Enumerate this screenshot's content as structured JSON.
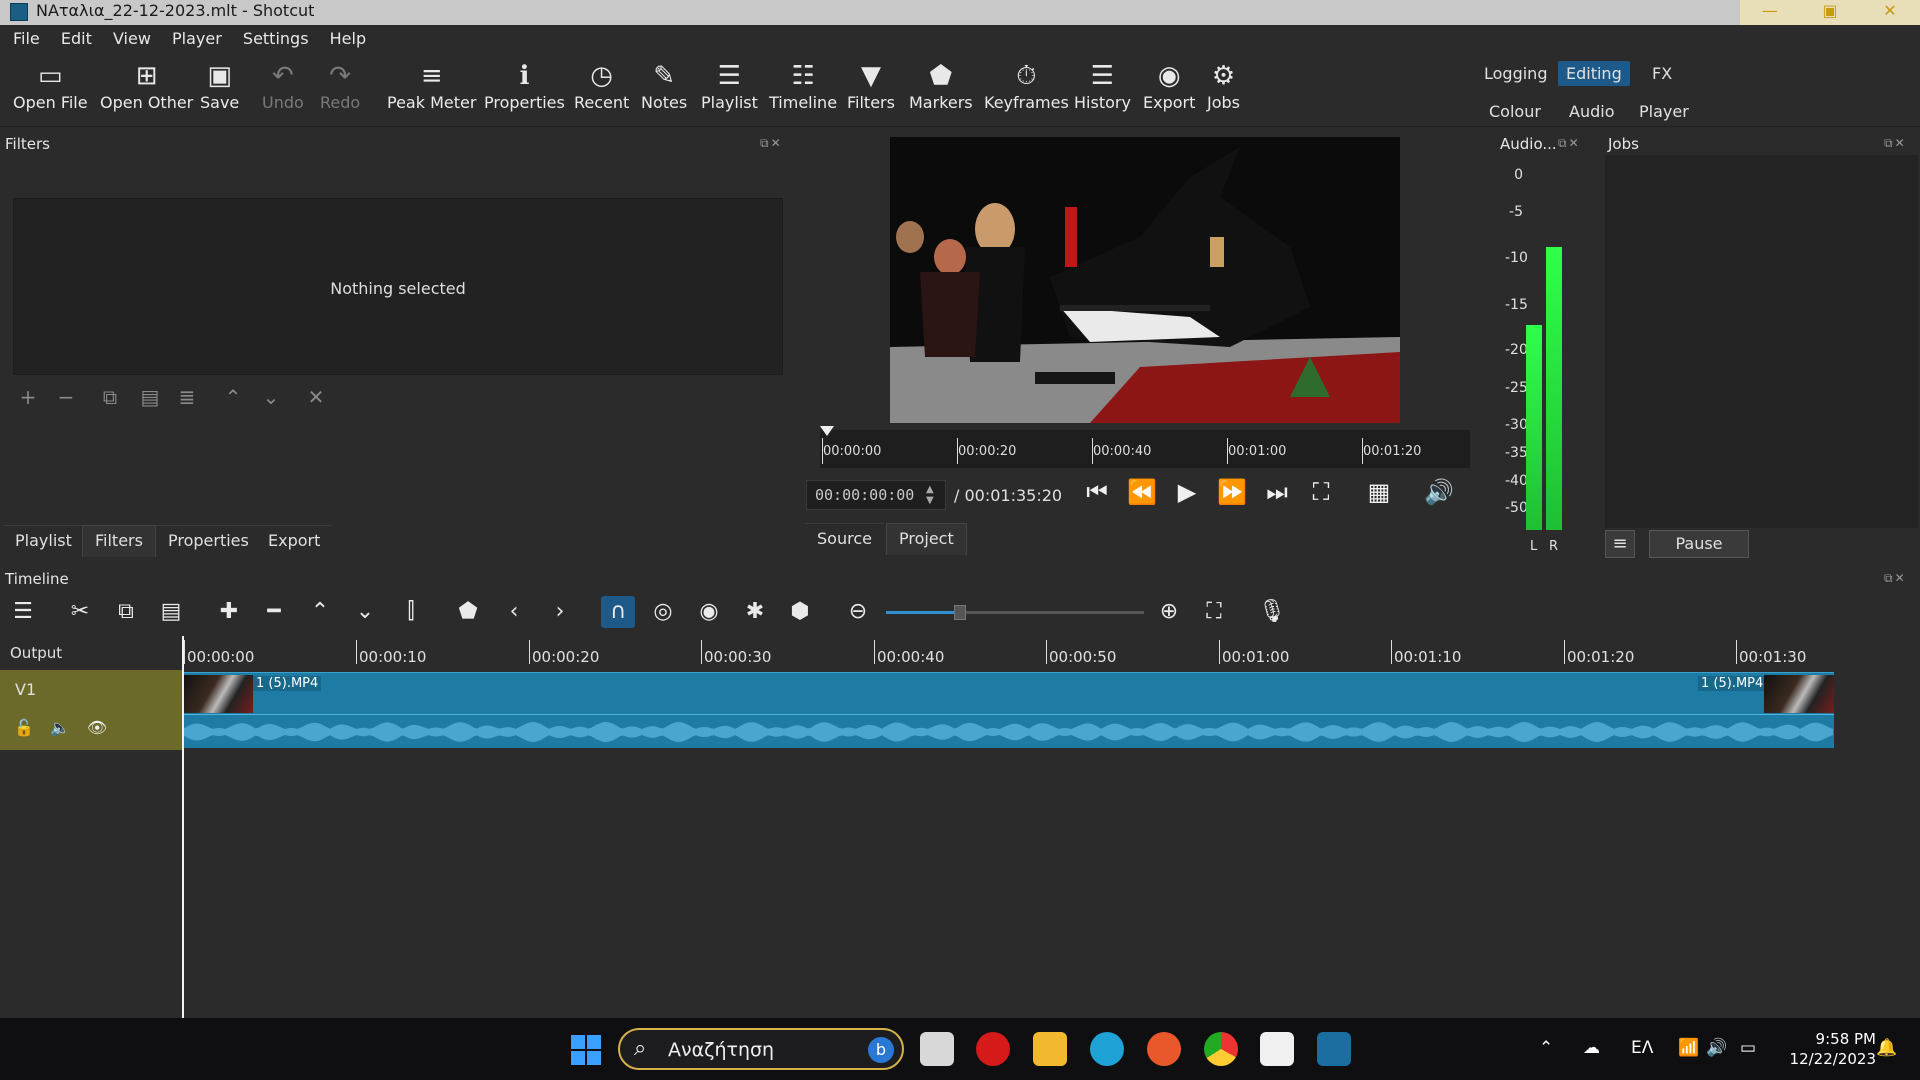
{
  "window": {
    "title": "NΑταλια_22-12-2023.mlt - Shotcut",
    "minimize": "—",
    "maximize": "▣",
    "close": "✕"
  },
  "menu": [
    "File",
    "Edit",
    "View",
    "Player",
    "Settings",
    "Help"
  ],
  "toolbar": [
    {
      "label": "Open File",
      "icon": "open-file-icon",
      "glyph": "▭"
    },
    {
      "label": "Open Other",
      "icon": "open-other-icon",
      "glyph": "⊞"
    },
    {
      "label": "Save",
      "icon": "save-icon",
      "glyph": "▣"
    },
    {
      "label": "Undo",
      "icon": "undo-icon",
      "glyph": "↶"
    },
    {
      "label": "Redo",
      "icon": "redo-icon",
      "glyph": "↷"
    },
    {
      "label": "Peak Meter",
      "icon": "peak-meter-icon",
      "glyph": "≡"
    },
    {
      "label": "Properties",
      "icon": "properties-icon",
      "glyph": "ℹ"
    },
    {
      "label": "Recent",
      "icon": "recent-icon",
      "glyph": "◷"
    },
    {
      "label": "Notes",
      "icon": "notes-icon",
      "glyph": "✎"
    },
    {
      "label": "Playlist",
      "icon": "playlist-icon",
      "glyph": "☰"
    },
    {
      "label": "Timeline",
      "icon": "timeline-icon",
      "glyph": "☷"
    },
    {
      "label": "Filters",
      "icon": "filters-icon",
      "glyph": "▼"
    },
    {
      "label": "Markers",
      "icon": "markers-icon",
      "glyph": "⬟"
    },
    {
      "label": "Keyframes",
      "icon": "keyframes-icon",
      "glyph": "⏱"
    },
    {
      "label": "History",
      "icon": "history-icon",
      "glyph": "☰"
    },
    {
      "label": "Export",
      "icon": "export-icon",
      "glyph": "◉"
    },
    {
      "label": "Jobs",
      "icon": "jobs-icon",
      "glyph": "⚙"
    }
  ],
  "layouts": {
    "logging": "Logging",
    "editing": "Editing",
    "fx": "FX",
    "colour": "Colour",
    "audio": "Audio",
    "player": "Player"
  },
  "filters_panel": {
    "title": "Filters",
    "empty_text": "Nothing selected"
  },
  "left_tabs": [
    "Playlist",
    "Filters",
    "Properties",
    "Export"
  ],
  "preview": {
    "ruler_ticks": [
      "00:00:00",
      "00:00:20",
      "00:00:40",
      "00:01:00",
      "00:01:20"
    ],
    "timecode": "00:00:00:00",
    "duration": "/ 00:01:35:20",
    "tabs": [
      "Source",
      "Project"
    ]
  },
  "audio_meter": {
    "title": "Audio...",
    "scale": [
      "0",
      "-5",
      "-10",
      "-15",
      "-20",
      "-25",
      "-30",
      "-35",
      "-40",
      "-50"
    ],
    "left_label": "L",
    "right_label": "R",
    "left_level_db": -21,
    "right_level_db": -10
  },
  "jobs_panel": {
    "title": "Jobs",
    "menu_glyph": "≡",
    "pause_label": "Pause"
  },
  "timeline": {
    "title": "Timeline",
    "output_label": "Output",
    "track_name": "V1",
    "ruler_ticks": [
      "00:00:00",
      "00:00:10",
      "00:00:20",
      "00:00:30",
      "00:00:40",
      "00:00:50",
      "00:01:00",
      "00:01:10",
      "00:01:20",
      "00:01:30"
    ],
    "clip_label_start": "1 (5).MP4",
    "clip_label_end": "1 (5).MP4"
  },
  "taskbar": {
    "search_placeholder": "Αναζήτηση",
    "language": "ΕΛ",
    "time": "9:58 PM",
    "date": "12/22/2023"
  },
  "colors": {
    "accent": "#1d5a8a",
    "clip": "#1e7ba4",
    "track_header": "#6b6a2a",
    "meter_green": "#2fff4a"
  }
}
